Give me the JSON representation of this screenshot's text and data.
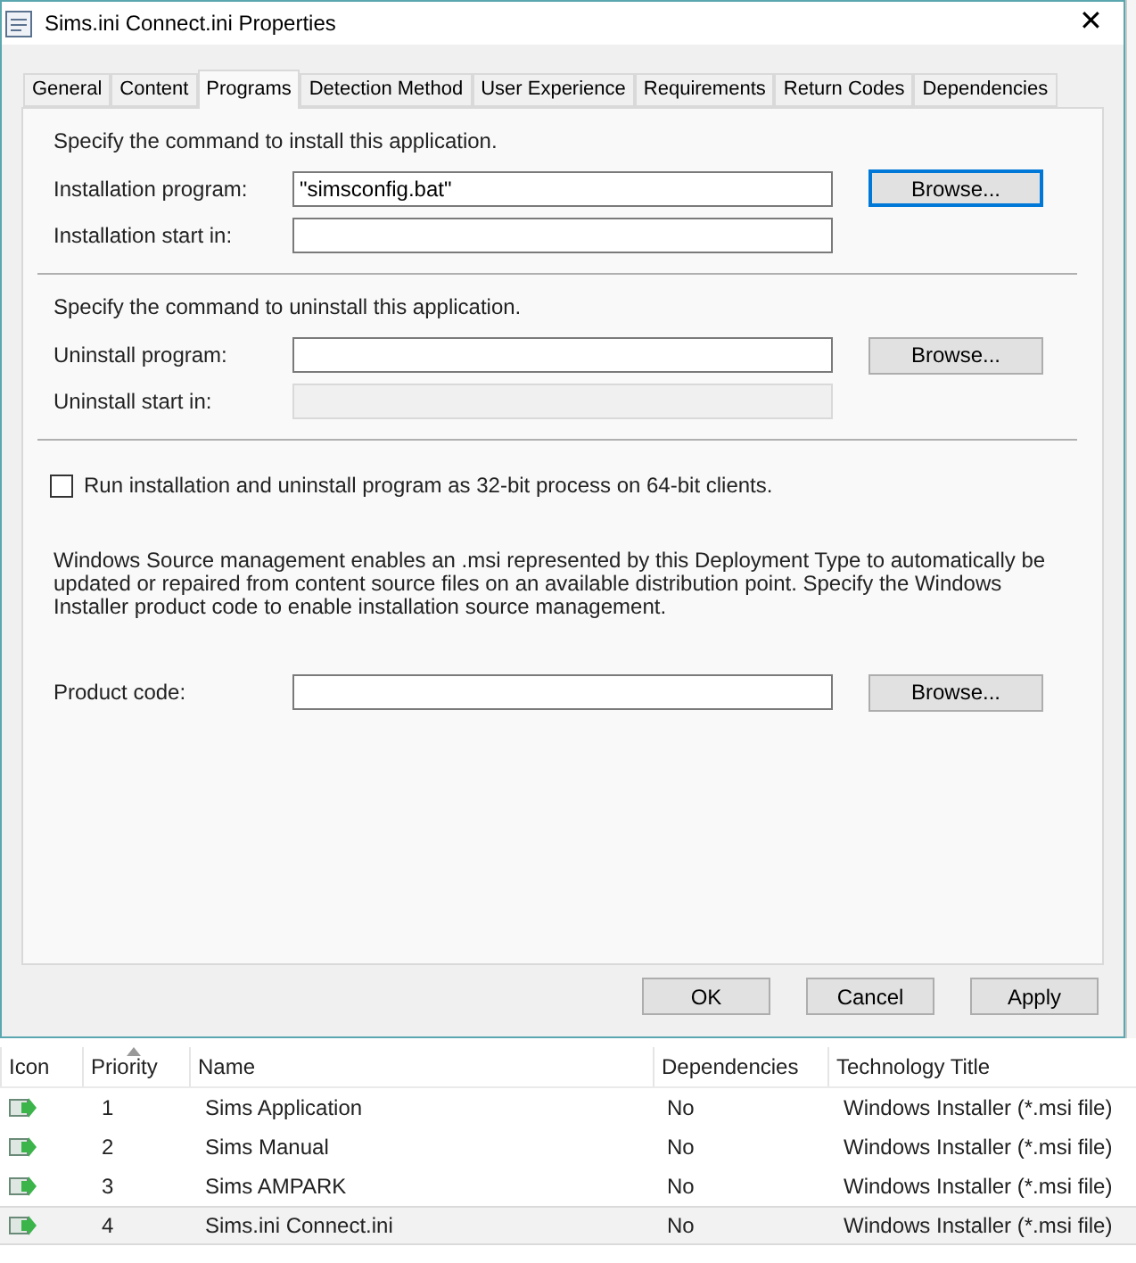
{
  "window": {
    "title": "Sims.ini Connect.ini Properties",
    "close": "✕"
  },
  "tabs": [
    {
      "label": "General",
      "selected": false
    },
    {
      "label": "Content",
      "selected": false
    },
    {
      "label": "Programs",
      "selected": true
    },
    {
      "label": "Detection Method",
      "selected": false
    },
    {
      "label": "User Experience",
      "selected": false
    },
    {
      "label": "Requirements",
      "selected": false
    },
    {
      "label": "Return Codes",
      "selected": false
    },
    {
      "label": "Dependencies",
      "selected": false
    }
  ],
  "install": {
    "heading": "Specify the command to install this application.",
    "fields": [
      {
        "label": "Installation program:",
        "value": "\"simsconfig.bat\"",
        "disabled": false,
        "browse": {
          "label": "Browse...",
          "focused": true
        }
      },
      {
        "label": "Installation start in:",
        "disabled": false
      }
    ]
  },
  "uninstall": {
    "heading": "Specify the command to uninstall this application.",
    "fields": [
      {
        "label": "Uninstall program:",
        "disabled": false,
        "browse": {
          "label": "Browse...",
          "focused": false
        }
      },
      {
        "label": "Uninstall start in:",
        "disabled": true
      }
    ]
  },
  "option": {
    "label": "Run installation and uninstall program as 32-bit process on 64-bit clients.",
    "checked": false
  },
  "source_management": {
    "text": "Windows Source management enables an .msi represented by this Deployment Type to automatically be updated or repaired from content source files on an available distribution point. Specify the Windows Installer product code to enable installation source management.",
    "field": {
      "label": "Product code:",
      "disabled": false,
      "browse": {
        "label": "Browse...",
        "focused": false
      }
    }
  },
  "buttons": [
    "OK",
    "Cancel",
    "Apply"
  ],
  "table": {
    "columns": [
      {
        "label": "Icon",
        "sorted": false
      },
      {
        "label": "Priority",
        "sorted": true
      },
      {
        "label": "Name",
        "sorted": false
      },
      {
        "label": "Dependencies",
        "sorted": false
      },
      {
        "label": "Technology Title",
        "sorted": false
      }
    ],
    "rows": [
      {
        "priority": "1",
        "name": "Sims Application",
        "dependencies": "No",
        "technology": "Windows Installer (*.msi file)",
        "selected": false
      },
      {
        "priority": "2",
        "name": "Sims Manual",
        "dependencies": "No",
        "technology": "Windows Installer (*.msi file)",
        "selected": false
      },
      {
        "priority": "3",
        "name": "Sims AMPARK",
        "dependencies": "No",
        "technology": "Windows Installer (*.msi file)",
        "selected": false
      },
      {
        "priority": "4",
        "name": "Sims.ini Connect.ini",
        "dependencies": "No",
        "technology": "Windows Installer (*.msi file)",
        "selected": true
      }
    ]
  }
}
